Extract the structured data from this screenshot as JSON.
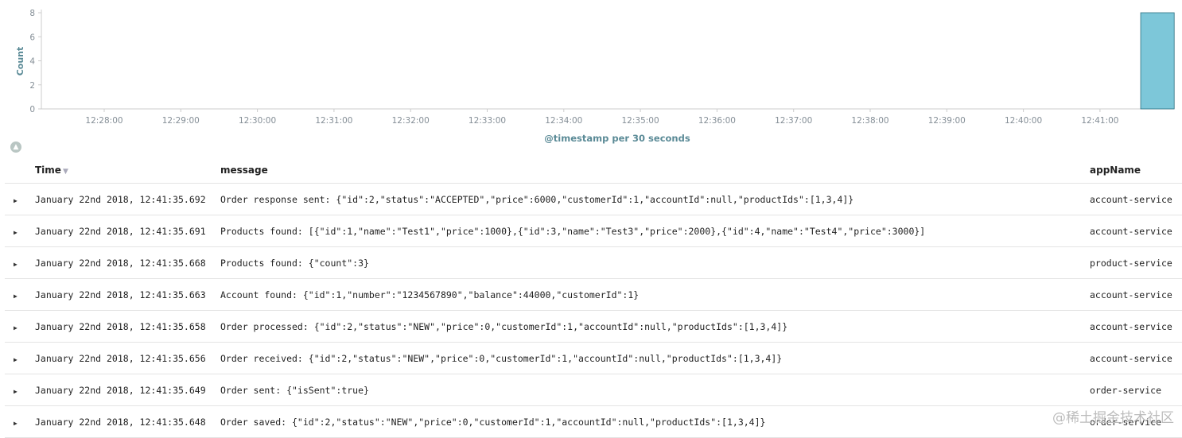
{
  "chart_data": {
    "type": "bar",
    "ylabel": "Count",
    "xlabel": "@timestamp per 30 seconds",
    "y_ticks": [
      "0",
      "2",
      "4",
      "6",
      "8"
    ],
    "ylim": [
      0,
      8
    ],
    "x_ticks": [
      "12:28:00",
      "12:29:00",
      "12:30:00",
      "12:31:00",
      "12:32:00",
      "12:33:00",
      "12:34:00",
      "12:35:00",
      "12:36:00",
      "12:37:00",
      "12:38:00",
      "12:39:00",
      "12:40:00",
      "12:41:00"
    ],
    "categories": [
      "12:41:30"
    ],
    "values": [
      8
    ],
    "bar_color": "#7dc7d9",
    "grid": false
  },
  "table": {
    "headers": {
      "time": "Time",
      "message": "message",
      "app": "appName"
    },
    "rows": [
      {
        "time": "January 22nd 2018, 12:41:35.692",
        "message": "Order response sent: {\"id\":2,\"status\":\"ACCEPTED\",\"price\":6000,\"customerId\":1,\"accountId\":null,\"productIds\":[1,3,4]}",
        "app": "account-service"
      },
      {
        "time": "January 22nd 2018, 12:41:35.691",
        "message": "Products found: [{\"id\":1,\"name\":\"Test1\",\"price\":1000},{\"id\":3,\"name\":\"Test3\",\"price\":2000},{\"id\":4,\"name\":\"Test4\",\"price\":3000}]",
        "app": "account-service"
      },
      {
        "time": "January 22nd 2018, 12:41:35.668",
        "message": "Products found: {\"count\":3}",
        "app": "product-service"
      },
      {
        "time": "January 22nd 2018, 12:41:35.663",
        "message": "Account found: {\"id\":1,\"number\":\"1234567890\",\"balance\":44000,\"customerId\":1}",
        "app": "account-service"
      },
      {
        "time": "January 22nd 2018, 12:41:35.658",
        "message": "Order processed: {\"id\":2,\"status\":\"NEW\",\"price\":0,\"customerId\":1,\"accountId\":null,\"productIds\":[1,3,4]}",
        "app": "account-service"
      },
      {
        "time": "January 22nd 2018, 12:41:35.656",
        "message": "Order received: {\"id\":2,\"status\":\"NEW\",\"price\":0,\"customerId\":1,\"accountId\":null,\"productIds\":[1,3,4]}",
        "app": "account-service"
      },
      {
        "time": "January 22nd 2018, 12:41:35.649",
        "message": "Order sent: {\"isSent\":true}",
        "app": "order-service"
      },
      {
        "time": "January 22nd 2018, 12:41:35.648",
        "message": "Order saved: {\"id\":2,\"status\":\"NEW\",\"price\":0,\"customerId\":1,\"accountId\":null,\"productIds\":[1,3,4]}",
        "app": "order-service"
      }
    ]
  },
  "watermark": "@稀土掘金技术社区",
  "icons": {
    "collapse": "chart-collapse-icon",
    "expand": "expand-row-icon",
    "sort": "sort-down-icon"
  }
}
